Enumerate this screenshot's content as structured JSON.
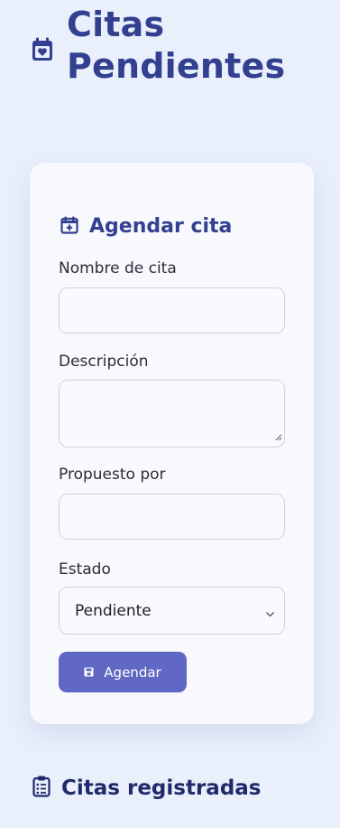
{
  "header": {
    "title_line1": "Citas",
    "title_line2": "Pendientes",
    "icon": "calendar-heart-icon"
  },
  "form": {
    "title": "Agendar cita",
    "title_icon": "calendar-plus-icon",
    "fields": [
      {
        "label": "Nombre de cita",
        "value": ""
      },
      {
        "label": "Descripción",
        "value": ""
      },
      {
        "label": "Propuesto por",
        "value": ""
      },
      {
        "label": "Estado",
        "value": "Pendiente",
        "options_visible": [
          "Pendiente"
        ]
      }
    ],
    "submit_label": "Agendar",
    "submit_icon": "save-icon"
  },
  "list": {
    "title": "Citas registradas",
    "icon": "clipboard-list-icon"
  },
  "colors": {
    "background": "#e9effb",
    "card": "#f8f9fd",
    "accent": "#333f8f",
    "button": "#6068c4"
  }
}
